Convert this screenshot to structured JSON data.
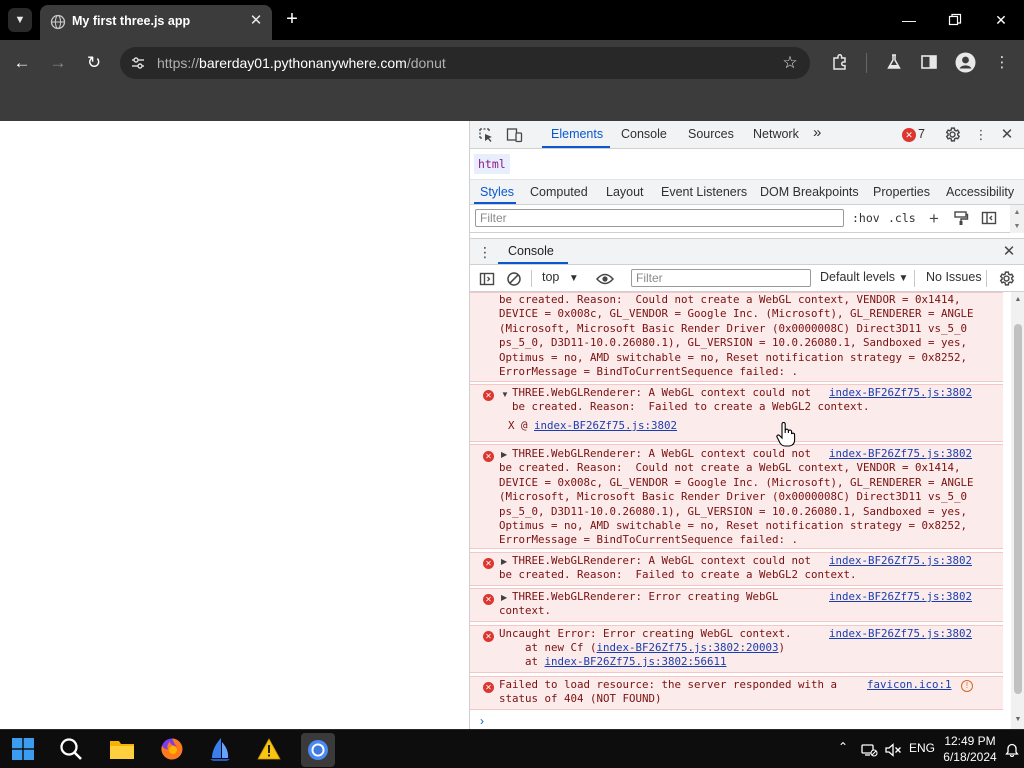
{
  "browser": {
    "tab_menu_icon": "chevron-down-icon",
    "tab_title": "My first three.js app",
    "url_protocol": "https://",
    "url_host": "barerday01.pythonanywhere.com",
    "url_path": "/donut",
    "accent": "#0b57d0"
  },
  "devtools": {
    "tabs": [
      "Elements",
      "Console",
      "Sources",
      "Network"
    ],
    "more_tabs": "»",
    "error_count": "7",
    "breadcrumb": "html",
    "styles_tabs": [
      "Styles",
      "Computed",
      "Layout",
      "Event Listeners",
      "DOM Breakpoints",
      "Properties",
      "Accessibility"
    ],
    "styles_filter_placeholder": "Filter",
    "hov": ":hov",
    "cls": ".cls",
    "drawer_tab": "Console",
    "console": {
      "context": "top",
      "filter_placeholder": "Filter",
      "levels": "Default levels",
      "issues": "No Issues",
      "error_color": "#dc362e"
    }
  },
  "messages": [
    {
      "text": "be created. Reason:  Could not create a WebGL context, VENDOR = 0x1414,\nDEVICE = 0x008c, GL_VENDOR = Google Inc. (Microsoft), GL_RENDERER = ANGLE\n(Microsoft, Microsoft Basic Render Driver (0x0000008C) Direct3D11 vs_5_0\nps_5_0, D3D11-10.0.26080.1), GL_VERSION = 10.0.26080.1, Sandboxed = yes,\nOptimus = no, AMD switchable = no, Reset notification strategy = 0x8252,\nErrorMessage = BindToCurrentSequence failed: ."
    },
    {
      "text": "THREE.WebGLRenderer: A WebGL context could not\nbe created. Reason:  Failed to create a WebGL2 context.",
      "link": "index-BF26Zf75.js:3802",
      "stack_prefix": "X @ ",
      "stack_link": "index-BF26Zf75.js:3802"
    },
    {
      "text": "THREE.WebGLRenderer: A WebGL context could not\nbe created. Reason:  Could not create a WebGL context, VENDOR = 0x1414,\nDEVICE = 0x008c, GL_VENDOR = Google Inc. (Microsoft), GL_RENDERER = ANGLE\n(Microsoft, Microsoft Basic Render Driver (0x0000008C) Direct3D11 vs_5_0\nps_5_0, D3D11-10.0.26080.1), GL_VERSION = 10.0.26080.1, Sandboxed = yes,\nOptimus = no, AMD switchable = no, Reset notification strategy = 0x8252,\nErrorMessage = BindToCurrentSequence failed: .",
      "link": "index-BF26Zf75.js:3802"
    },
    {
      "text": "THREE.WebGLRenderer: A WebGL context could not\nbe created. Reason:  Failed to create a WebGL2 context.",
      "link": "index-BF26Zf75.js:3802"
    },
    {
      "text": "THREE.WebGLRenderer: Error creating WebGL\ncontext.",
      "link": "index-BF26Zf75.js:3802"
    },
    {
      "text": "Uncaught Error: Error creating WebGL context.",
      "link": "index-BF26Zf75.js:3802",
      "stack1_prefix": "    at new Cf (",
      "stack1_link": "index-BF26Zf75.js:3802:20003",
      "stack1_suffix": ")",
      "stack2_prefix": "    at ",
      "stack2_link": "index-BF26Zf75.js:3802:56611"
    },
    {
      "text": "Failed to load resource: the server responded with a\nstatus of 404 (NOT FOUND)",
      "link": "favicon.ico:1"
    }
  ],
  "taskbar": {
    "language": "ENG",
    "time": "12:49 PM",
    "date": "6/18/2024"
  }
}
